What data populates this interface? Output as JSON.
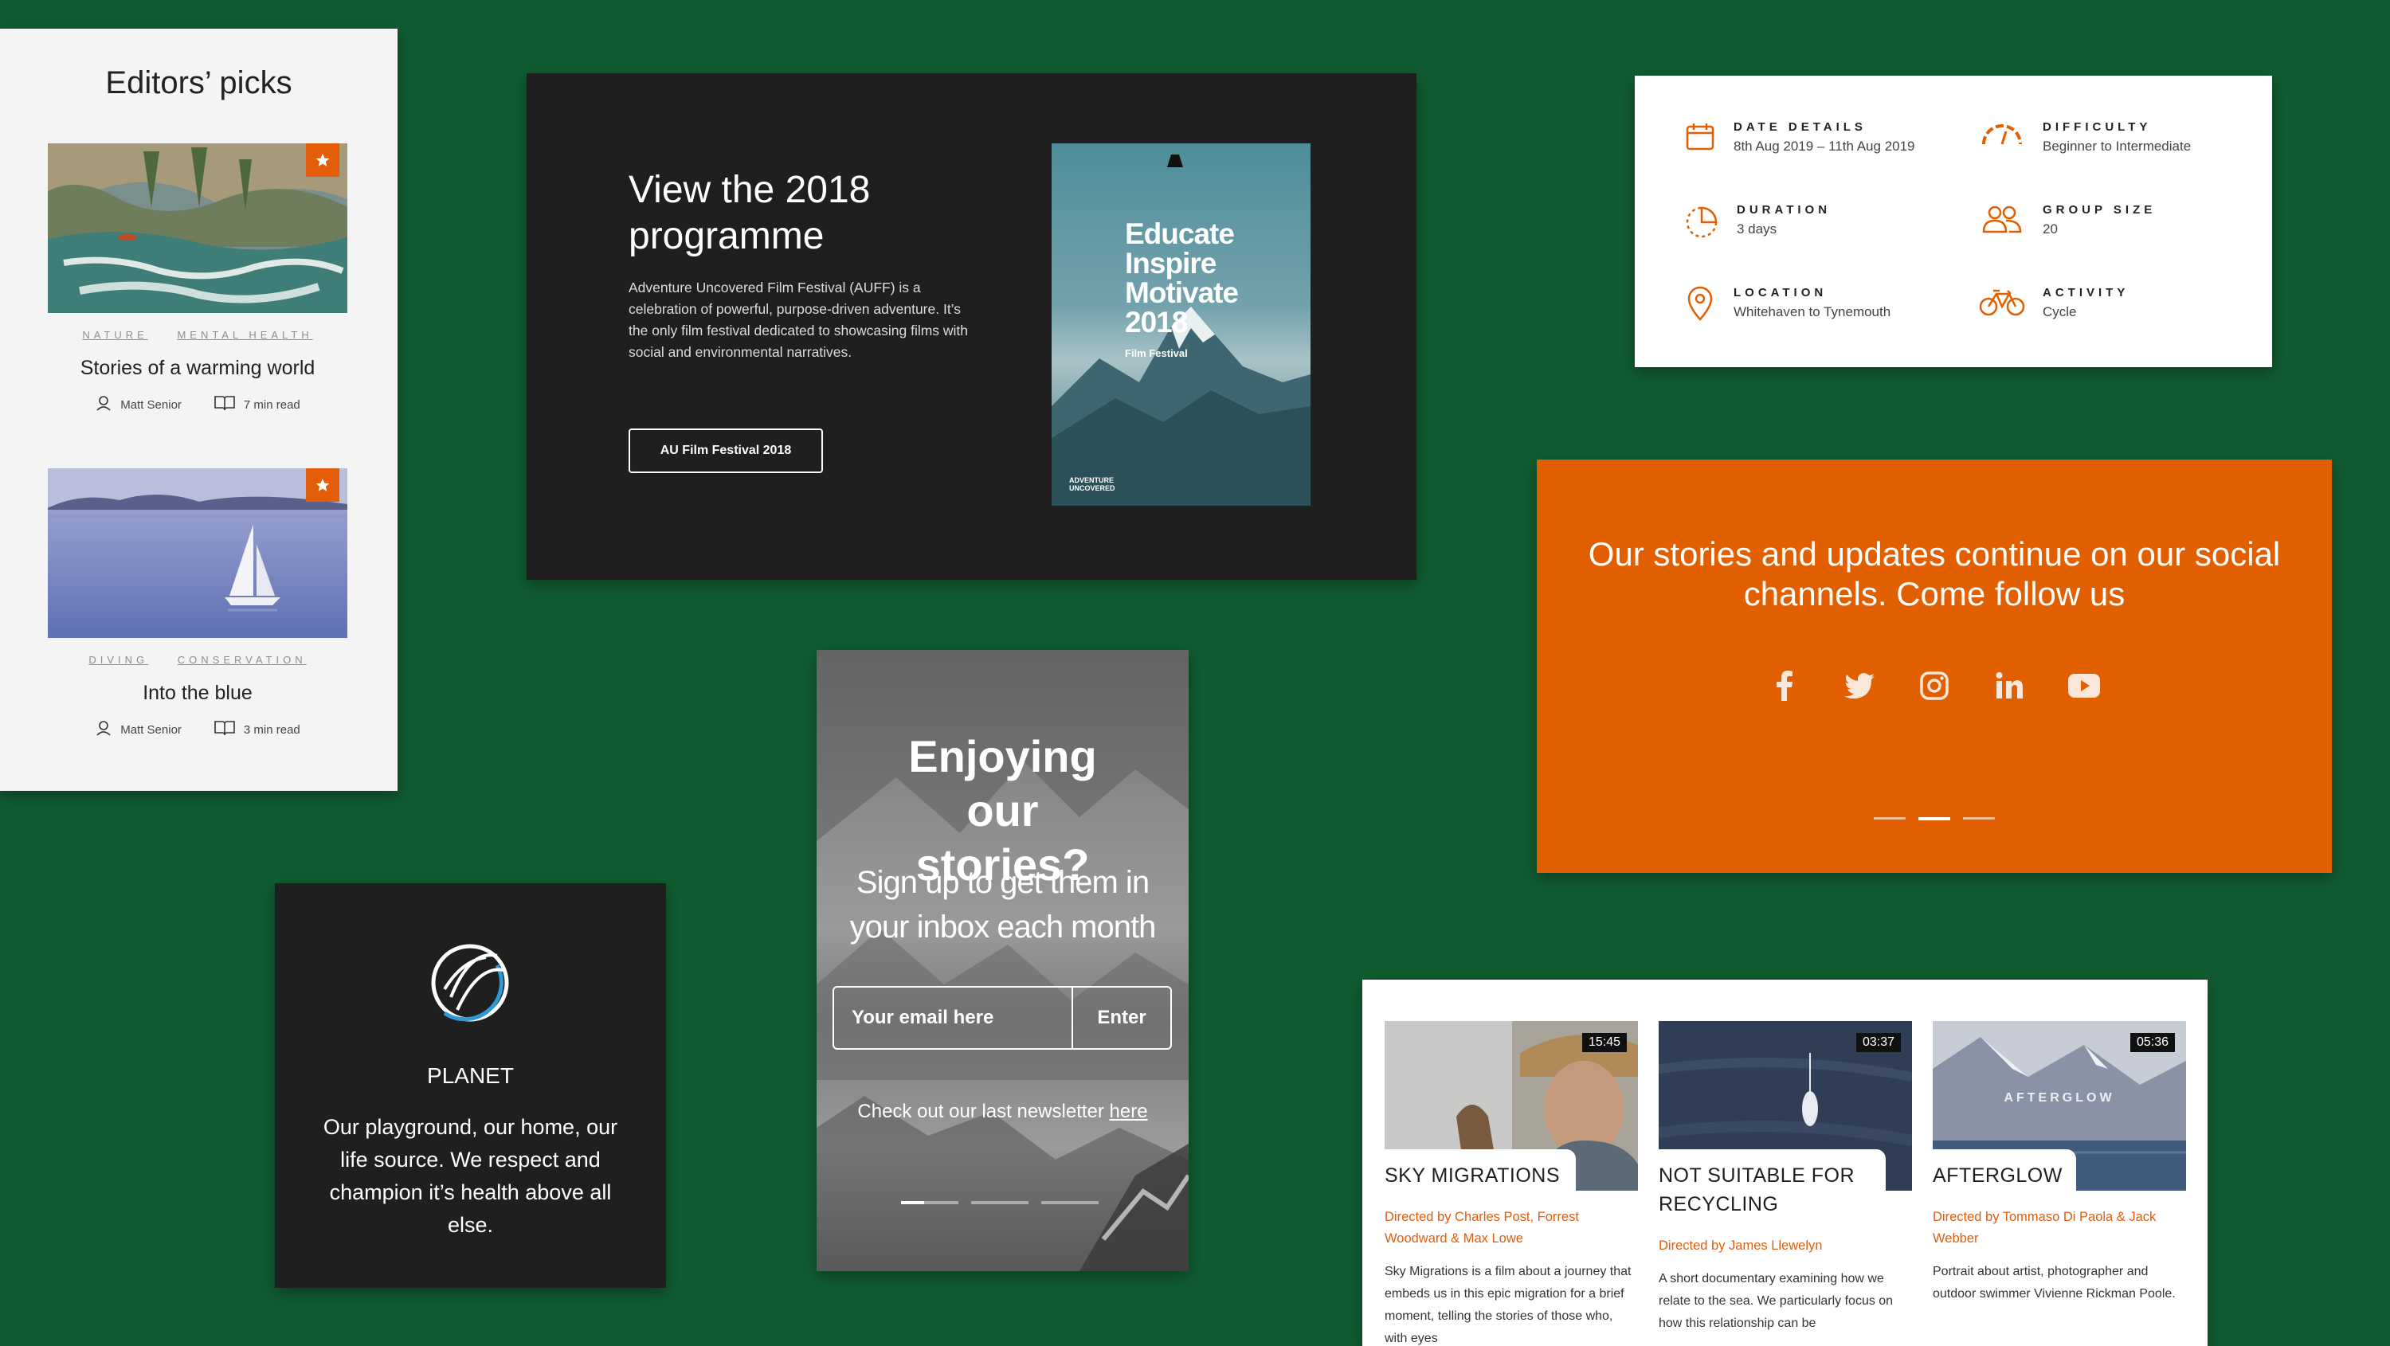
{
  "editors_picks": {
    "title": "Editors’ picks",
    "items": [
      {
        "tags": [
          "NATURE",
          "MENTAL HEALTH"
        ],
        "title": "Stories of a warming world",
        "author": "Matt Senior",
        "read_time": "7 min read"
      },
      {
        "tags": [
          "DIVING",
          "CONSERVATION"
        ],
        "title": "Into the blue",
        "author": "Matt Senior",
        "read_time": "3 min read"
      }
    ]
  },
  "programme": {
    "heading": "View the 2018 programme",
    "description": "Adventure Uncovered Film Festival (AUFF) is a celebration of powerful, purpose-driven adventure. It’s the only film festival dedicated to showcasing films with social and environmental narratives.",
    "button_label": "AU Film Festival 2018",
    "poster": {
      "lines": [
        "Educate",
        "Inspire",
        "Motivate",
        "2018"
      ],
      "sub": "Film Festival",
      "footer": [
        "ADVENTURE",
        "UNCOVERED"
      ]
    }
  },
  "trip_details": [
    {
      "icon": "calendar-icon",
      "label": "DATE DETAILS",
      "value": "8th Aug 2019 – 11th Aug 2019"
    },
    {
      "icon": "gauge-icon",
      "label": "DIFFICULTY",
      "value": "Beginner to Intermediate"
    },
    {
      "icon": "clock-icon",
      "label": "DURATION",
      "value": "3 days"
    },
    {
      "icon": "group-icon",
      "label": "GROUP SIZE",
      "value": "20"
    },
    {
      "icon": "location-pin-icon",
      "label": "LOCATION",
      "value": "Whitehaven to Tynemouth"
    },
    {
      "icon": "bicycle-icon",
      "label": "ACTIVITY",
      "value": "Cycle"
    }
  ],
  "social": {
    "text": "Our stories and updates continue on our social channels. Come follow us",
    "icons": [
      "facebook-icon",
      "twitter-icon",
      "instagram-icon",
      "linkedin-icon",
      "youtube-icon"
    ],
    "carousel_active": 2,
    "carousel_count": 3
  },
  "newsletter": {
    "heading": "Enjoying our stories?",
    "subheading": "Sign up to get them in your inbox each month",
    "email_placeholder": "Your email here",
    "submit_label": "Enter",
    "check_text": "Check out our last newsletter ",
    "check_link": "here",
    "carousel_active": 1,
    "carousel_count": 3
  },
  "planet": {
    "name": "PLANET",
    "text": "Our playground, our home, our life source. We respect and champion it’s health above all else."
  },
  "films": [
    {
      "duration": "15:45",
      "title": "SKY MIGRATIONS",
      "directors": "Directed by Charles Post, Forrest Woodward & Max Lowe",
      "description": "Sky Migrations is a film about a journey that embeds us in this epic migration for a brief moment, telling the stories of those who, with eyes"
    },
    {
      "duration": "03:37",
      "title": "NOT SUITABLE FOR RECYCLING",
      "directors": "Directed by James Llewelyn",
      "description": "A short documentary examining how we relate to the sea. We particularly focus on how this relationship can be"
    },
    {
      "duration": "05:36",
      "title": "AFTERGLOW",
      "thumb_text": "AFTERGLOW",
      "directors": "Directed by Tommaso Di Paola & Jack Webber",
      "description": "Portrait about artist, photographer and outdoor swimmer Vivienne Rickman Poole."
    }
  ],
  "colors": {
    "background": "#115c30",
    "accent": "#e25f00",
    "dark": "#1f1f1f"
  }
}
